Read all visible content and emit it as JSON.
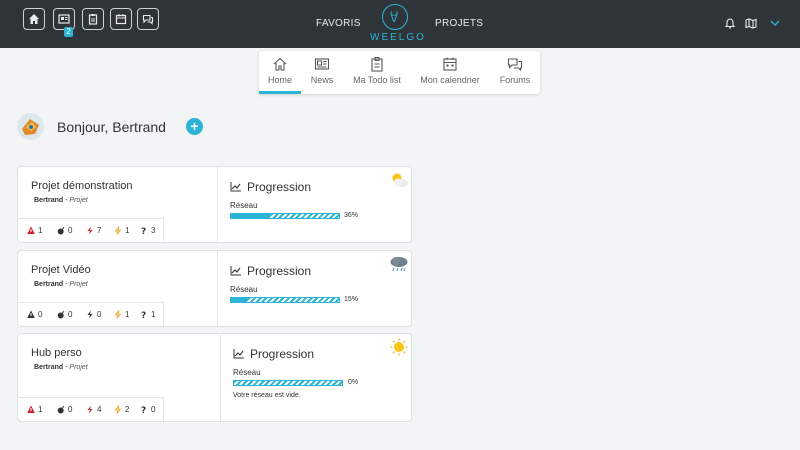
{
  "topbar": {
    "badge_count": "2",
    "nav": {
      "favoris": "FAVORIS",
      "projets": "PROJETS"
    },
    "logo_text": "WEELGO",
    "bg_color": "#2f3438",
    "accent_color": "#2bb4d6"
  },
  "subnav": {
    "items": [
      {
        "label": "Home",
        "icon": "home-icon",
        "active": true
      },
      {
        "label": "News",
        "icon": "newspaper-icon"
      },
      {
        "label": "Ma Todo list",
        "icon": "clipboard-icon"
      },
      {
        "label": "Mon calendrier",
        "icon": "calendar-icon"
      },
      {
        "label": "Forums",
        "icon": "chat-icon"
      }
    ]
  },
  "greeting": {
    "text": "Bonjour, Bertrand",
    "add_label": "+"
  },
  "projects": [
    {
      "name": "Projet démonstration",
      "owner": "Bertrand",
      "role": "Projet",
      "stats": {
        "alerts": "1",
        "bombs": "0",
        "red_bolts": "7",
        "yellow_bolts": "1",
        "questions": "3"
      },
      "progress_title": "Progression",
      "reseau_label": "Réseau",
      "reseau_percent": 36,
      "reseau_percent_text": "36%",
      "weather": "partly-cloudy-icon"
    },
    {
      "name": "Projet Vidéo",
      "owner": "Bertrand",
      "role": "Projet",
      "stats": {
        "alerts": "0",
        "bombs": "0",
        "red_bolts": "0",
        "yellow_bolts": "1",
        "questions": "1"
      },
      "progress_title": "Progression",
      "reseau_label": "Réseau",
      "reseau_percent": 15,
      "reseau_percent_text": "15%",
      "weather": "rain-cloud-icon"
    },
    {
      "name": "Hub perso",
      "owner": "Bertrand",
      "role": "Projet",
      "stats": {
        "alerts": "1",
        "bombs": "0",
        "red_bolts": "4",
        "yellow_bolts": "2",
        "questions": "0"
      },
      "progress_title": "Progression",
      "reseau_label": "Réseau",
      "reseau_percent": 0,
      "reseau_percent_text": "0%",
      "empty_note": "Votre réseau est vide.",
      "weather": "sun-icon"
    }
  ]
}
